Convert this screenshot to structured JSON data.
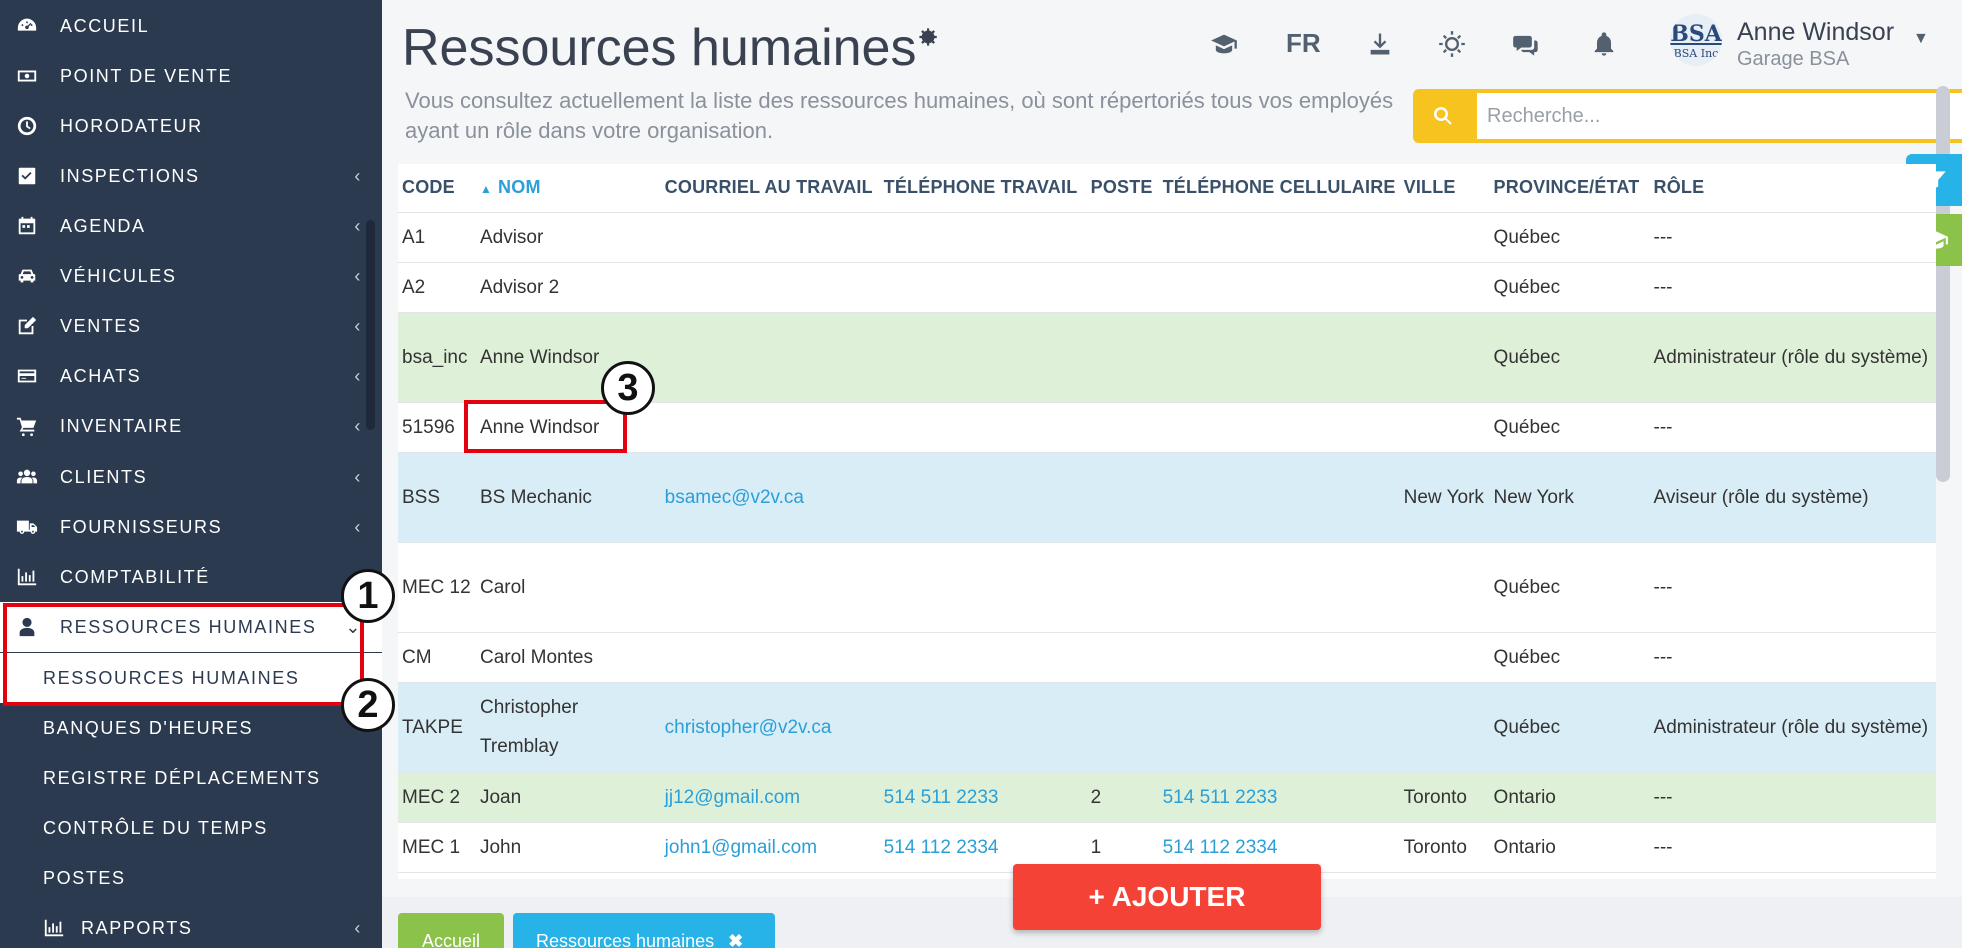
{
  "sidebar": {
    "items": [
      {
        "label": "ACCUEIL",
        "icon": "dashboard-icon",
        "chevron": false
      },
      {
        "label": "POINT DE VENTE",
        "icon": "money-icon",
        "chevron": false
      },
      {
        "label": "HORODATEUR",
        "icon": "clock-icon",
        "chevron": false
      },
      {
        "label": "INSPECTIONS",
        "icon": "checkbox-icon",
        "chevron": true
      },
      {
        "label": "AGENDA",
        "icon": "calendar-icon",
        "chevron": true
      },
      {
        "label": "VÉHICULES",
        "icon": "car-icon",
        "chevron": true
      },
      {
        "label": "VENTES",
        "icon": "edit-icon",
        "chevron": true
      },
      {
        "label": "ACHATS",
        "icon": "credit-card-icon",
        "chevron": true
      },
      {
        "label": "INVENTAIRE",
        "icon": "cart-icon",
        "chevron": true
      },
      {
        "label": "CLIENTS",
        "icon": "users-icon",
        "chevron": true
      },
      {
        "label": "FOURNISSEURS",
        "icon": "truck-icon",
        "chevron": true
      },
      {
        "label": "COMPTABILITÉ",
        "icon": "bar-chart-icon",
        "chevron": false
      },
      {
        "label": "RESSOURCES HUMAINES",
        "icon": "user-icon",
        "chevron": true
      }
    ],
    "sub_items": [
      {
        "label": "RESSOURCES HUMAINES"
      },
      {
        "label": "BANQUES D'HEURES"
      },
      {
        "label": "REGISTRE DÉPLACEMENTS"
      },
      {
        "label": "CONTRÔLE DU TEMPS"
      },
      {
        "label": "POSTES"
      },
      {
        "label": "RAPPORTS",
        "icon": "bar-chart-icon",
        "chevron": true
      }
    ],
    "chevron_glyph": "‹",
    "chevron_open_glyph": "⌄"
  },
  "header": {
    "title": "Ressources humaines",
    "subtitle": "Vous consultez actuellement la liste des ressources humaines, où sont répertoriés tous vos employés ayant un rôle dans votre organisation.",
    "language": "FR",
    "user_name": "Anne Windsor",
    "user_org": "Garage BSA",
    "avatar_top": "BSA",
    "avatar_bottom": "BSA Inc"
  },
  "search": {
    "placeholder": "Recherche..."
  },
  "table": {
    "columns": [
      {
        "label": "CODE",
        "sorted": false
      },
      {
        "label": "NOM",
        "sorted": true
      },
      {
        "label": "COURRIEL AU TRAVAIL",
        "sorted": false
      },
      {
        "label": "TÉLÉPHONE TRAVAIL",
        "sorted": false
      },
      {
        "label": "POSTE",
        "sorted": false
      },
      {
        "label": "TÉLÉPHONE CELLULAIRE",
        "sorted": false
      },
      {
        "label": "VILLE",
        "sorted": false
      },
      {
        "label": "PROVINCE/ÉTAT",
        "sorted": false
      },
      {
        "label": "RÔLE",
        "sorted": false
      }
    ],
    "rows": [
      {
        "code": "A1",
        "nom": "Advisor",
        "courriel": "",
        "tel_travail": "",
        "poste": "",
        "cellulaire": "",
        "ville": "",
        "province": "Québec",
        "role": "---",
        "style": "white"
      },
      {
        "code": "A2",
        "nom": "Advisor 2",
        "courriel": "",
        "tel_travail": "",
        "poste": "",
        "cellulaire": "",
        "ville": "",
        "province": "Québec",
        "role": "---",
        "style": "white"
      },
      {
        "code": "bsa_inc",
        "nom": "Anne Windsor",
        "courriel": "",
        "tel_travail": "",
        "poste": "",
        "cellulaire": "",
        "ville": "",
        "province": "Québec",
        "role": "Administrateur (rôle du système)",
        "style": "green"
      },
      {
        "code": "51596",
        "nom": "Anne Windsor",
        "courriel": "",
        "tel_travail": "",
        "poste": "",
        "cellulaire": "",
        "ville": "",
        "province": "Québec",
        "role": "---",
        "style": "white"
      },
      {
        "code": "BSS",
        "nom": "BS Mechanic",
        "courriel": "bsamec@v2v.ca",
        "tel_travail": "",
        "poste": "",
        "cellulaire": "",
        "ville": "New York",
        "province": "New York",
        "role": "Aviseur (rôle du système)",
        "style": "blue"
      },
      {
        "code": "MEC 12",
        "nom": "Carol",
        "courriel": "",
        "tel_travail": "",
        "poste": "",
        "cellulaire": "",
        "ville": "",
        "province": "Québec",
        "role": "---",
        "style": "white"
      },
      {
        "code": "CM",
        "nom": "Carol Montes",
        "courriel": "",
        "tel_travail": "",
        "poste": "",
        "cellulaire": "",
        "ville": "",
        "province": "Québec",
        "role": "---",
        "style": "white"
      },
      {
        "code": "TAKPE",
        "nom": "Christopher Tremblay",
        "courriel": "christopher@v2v.ca",
        "tel_travail": "",
        "poste": "",
        "cellulaire": "",
        "ville": "",
        "province": "Québec",
        "role": "Administrateur (rôle du système)",
        "style": "blue"
      },
      {
        "code": "MEC 2",
        "nom": "Joan",
        "courriel": "jj12@gmail.com",
        "tel_travail": "514 511 2233",
        "poste": "2",
        "cellulaire": "514 511 2233",
        "ville": "Toronto",
        "province": "Ontario",
        "role": "---",
        "style": "green"
      },
      {
        "code": "MEC 1",
        "nom": "John",
        "courriel": "john1@gmail.com",
        "tel_travail": "514 112 2334",
        "poste": "1",
        "cellulaire": "514 112 2334",
        "ville": "Toronto",
        "province": "Ontario",
        "role": "---",
        "style": "white"
      }
    ]
  },
  "buttons": {
    "add_label": "+ AJOUTER"
  },
  "tabs": {
    "home": "Accueil",
    "current": "Ressources humaines",
    "close_glyph": "✖"
  },
  "annotations": [
    "1",
    "2",
    "3"
  ],
  "colors": {
    "sidebar_bg": "#2c3a4f",
    "accent_blue": "#2a9fd8",
    "search_yellow": "#f6c31f",
    "add_red": "#f44336",
    "tab_green": "#8bc34a",
    "row_green": "#dff0d8",
    "row_blue": "#d9edf7",
    "annotation_red": "#e3000f"
  }
}
